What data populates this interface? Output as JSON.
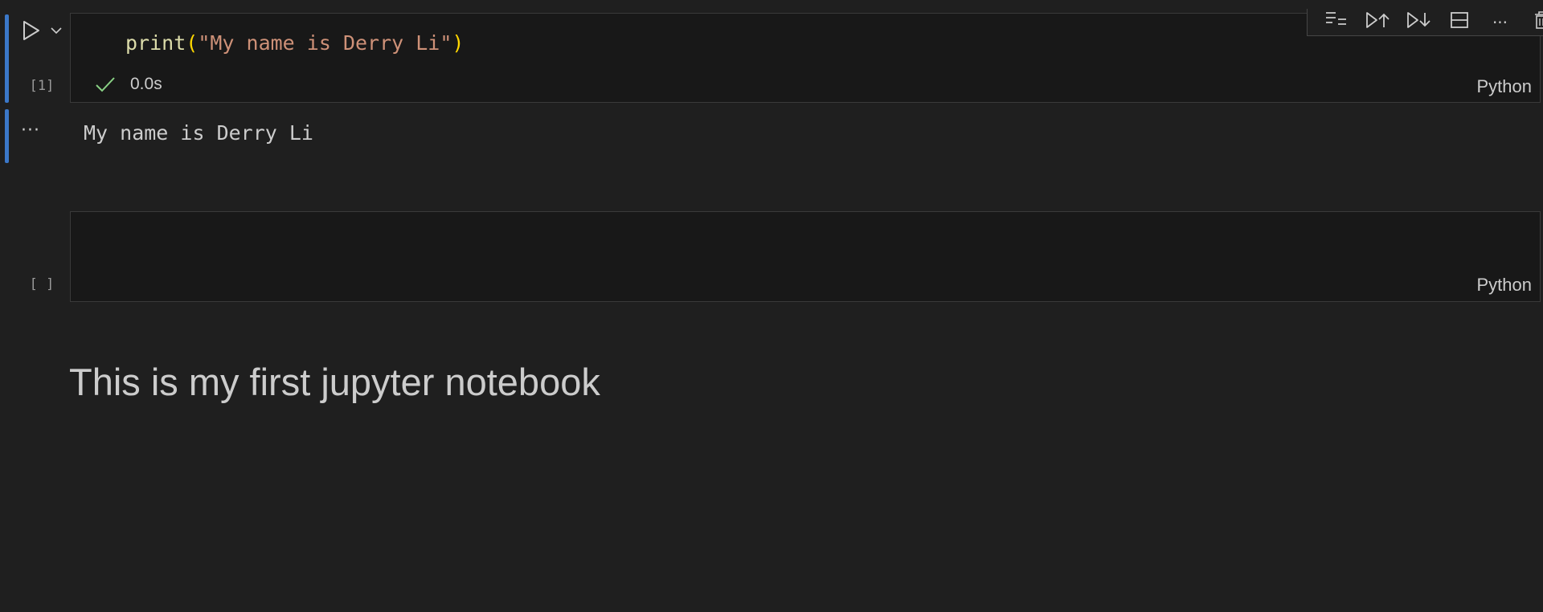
{
  "cells": {
    "first": {
      "execution_count": "[1]",
      "code": {
        "fn": "print",
        "open_paren": "(",
        "string": "\"My name is Derry Li\"",
        "close_paren": ")"
      },
      "status_time": "0.0s",
      "language": "Python",
      "output": {
        "collapse_label": "···",
        "text": "My name is Derry Li"
      }
    },
    "second": {
      "execution_count": "[ ]",
      "language": "Python"
    },
    "markdown": {
      "heading": "This is my first jupyter notebook"
    }
  },
  "toolbar": {
    "more_label": "···"
  },
  "colors": {
    "background": "#1f1f1f",
    "cell_background": "#181818",
    "focus_bar": "#3b78c9",
    "success_check": "#89d185",
    "string": "#ce9178",
    "function": "#dcdcaa",
    "bracket": "#ffd700"
  },
  "icons": {
    "run": "play-icon",
    "run_menu": "chevron-down-icon",
    "status": "check-icon",
    "toolbar": [
      "run-by-line-icon",
      "execute-above-icon",
      "execute-below-icon",
      "split-cell-icon",
      "more-actions-icon",
      "delete-icon"
    ]
  }
}
